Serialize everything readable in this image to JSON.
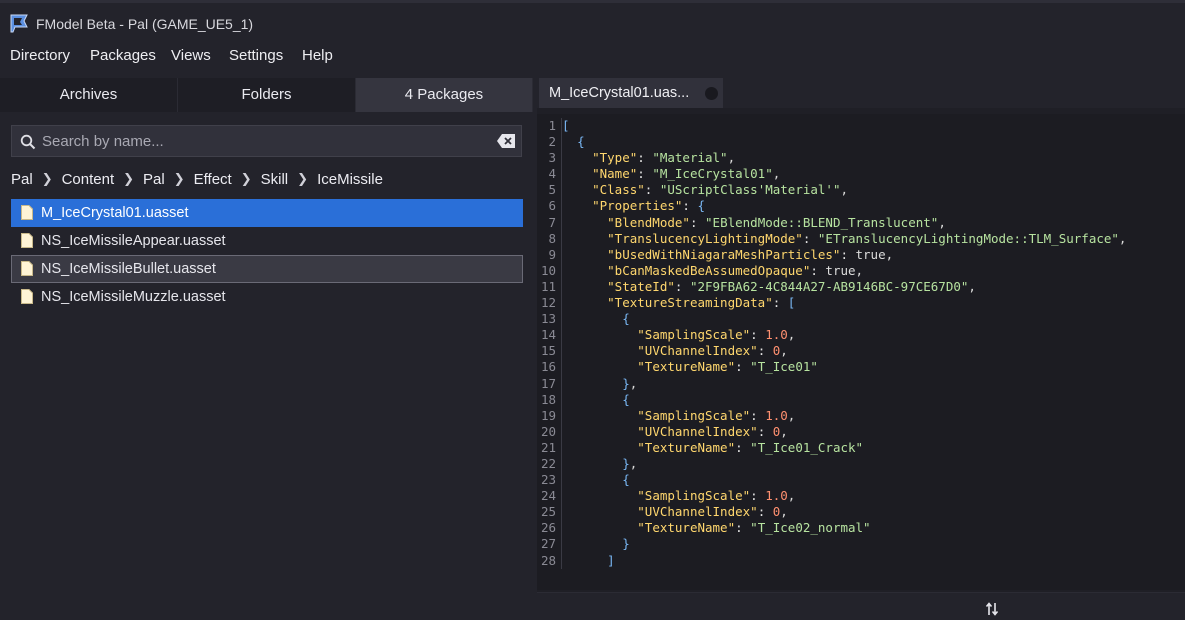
{
  "window": {
    "title": "FModel Beta - Pal (GAME_UE5_1)"
  },
  "menu": [
    "Directory",
    "Packages",
    "Views",
    "Settings",
    "Help"
  ],
  "left_tabs": [
    {
      "label": "Archives",
      "active": false
    },
    {
      "label": "Folders",
      "active": false
    },
    {
      "label": "4 Packages",
      "active": true
    }
  ],
  "search": {
    "placeholder": "Search by name..."
  },
  "breadcrumb": [
    "Pal",
    "Content",
    "Pal",
    "Effect",
    "Skill",
    "IceMissile"
  ],
  "files": [
    {
      "name": "M_IceCrystal01.uasset",
      "state": "selected"
    },
    {
      "name": "NS_IceMissileAppear.uasset",
      "state": "normal"
    },
    {
      "name": "NS_IceMissileBullet.uasset",
      "state": "hover"
    },
    {
      "name": "NS_IceMissileMuzzle.uasset",
      "state": "normal"
    }
  ],
  "document_tab": {
    "label": "M_IceCrystal01.uas..."
  },
  "code_lines": [
    "[",
    "  {",
    "    \"Type\": \"Material\",",
    "    \"Name\": \"M_IceCrystal01\",",
    "    \"Class\": \"UScriptClass'Material'\",",
    "    \"Properties\": {",
    "      \"BlendMode\": \"EBlendMode::BLEND_Translucent\",",
    "      \"TranslucencyLightingMode\": \"ETranslucencyLightingMode::TLM_Surface\",",
    "      \"bUsedWithNiagaraMeshParticles\": true,",
    "      \"bCanMaskedBeAssumedOpaque\": true,",
    "      \"StateId\": \"2F9FBA62-4C844A27-AB9146BC-97CE67D0\",",
    "      \"TextureStreamingData\": [",
    "        {",
    "          \"SamplingScale\": 1.0,",
    "          \"UVChannelIndex\": 0,",
    "          \"TextureName\": \"T_Ice01\"",
    "        },",
    "        {",
    "          \"SamplingScale\": 1.0,",
    "          \"UVChannelIndex\": 0,",
    "          \"TextureName\": \"T_Ice01_Crack\"",
    "        },",
    "        {",
    "          \"SamplingScale\": 1.0,",
    "          \"UVChannelIndex\": 0,",
    "          \"TextureName\": \"T_Ice02_normal\"",
    "        }",
    "      ]"
  ],
  "colors": {
    "accent": "#2a6fd8",
    "key": "#ffd76e",
    "string": "#b7e3a0",
    "number": "#ff9070",
    "boolean": "#6fb7f5"
  },
  "icons": [
    "app-logo",
    "search-icon",
    "clear-icon",
    "file-icon",
    "sort-arrows-icon"
  ]
}
